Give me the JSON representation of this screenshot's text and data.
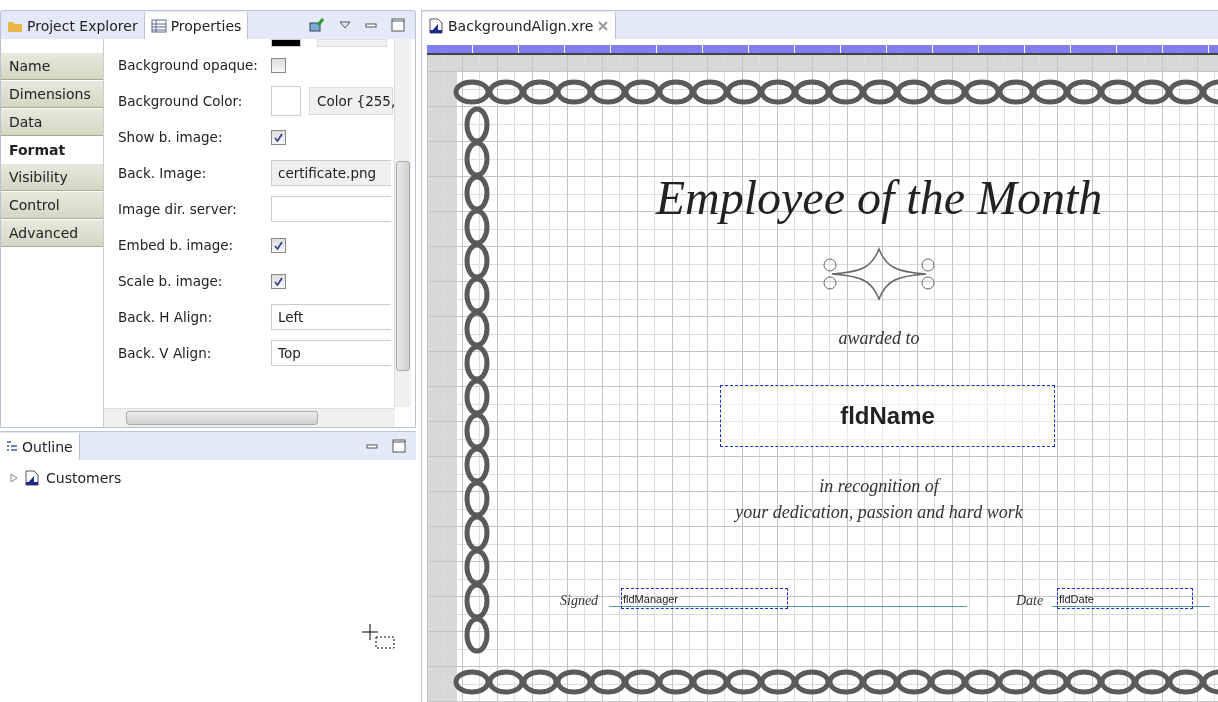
{
  "left_tabs": [
    {
      "label": "Project Explorer",
      "selected": false
    },
    {
      "label": "Properties",
      "selected": true
    }
  ],
  "categories": [
    {
      "label": "Name",
      "selected": false
    },
    {
      "label": "Dimensions",
      "selected": false
    },
    {
      "label": "Data",
      "selected": false
    },
    {
      "label": "Format",
      "selected": true
    },
    {
      "label": "Visibility",
      "selected": false
    },
    {
      "label": "Control",
      "selected": false
    },
    {
      "label": "Advanced",
      "selected": false
    }
  ],
  "properties": [
    {
      "kind": "checkbox",
      "label": "Background opaque:",
      "checked": false
    },
    {
      "kind": "color",
      "label": "Background Color:",
      "value": "Color {255,"
    },
    {
      "kind": "checkbox",
      "label": "Show b. image:",
      "checked": true
    },
    {
      "kind": "readonly",
      "label": "Back. Image:",
      "value": "certificate.png"
    },
    {
      "kind": "text",
      "label": "Image dir. server:"
    },
    {
      "kind": "checkbox",
      "label": "Embed b. image:",
      "checked": true
    },
    {
      "kind": "checkbox",
      "label": "Scale b. image:",
      "checked": true
    },
    {
      "kind": "text",
      "label": "Back. H Align:",
      "value": "Left"
    },
    {
      "kind": "text",
      "label": "Back. V Align:",
      "value": "Top"
    }
  ],
  "outline": {
    "title": "Outline",
    "items": [
      {
        "label": "Customers",
        "expanded": false
      }
    ]
  },
  "editor": {
    "tab": "BackgroundAlign.xre",
    "certificate": {
      "title": "Employee of the Month",
      "awarded": "awarded to",
      "name_field": "fldName",
      "recognition": [
        "in recognition of",
        "your dedication, passion and hard work"
      ],
      "signed_label": "Signed",
      "manager_field": "fldManager",
      "date_label": "Date",
      "date_field": "fldDate"
    }
  }
}
